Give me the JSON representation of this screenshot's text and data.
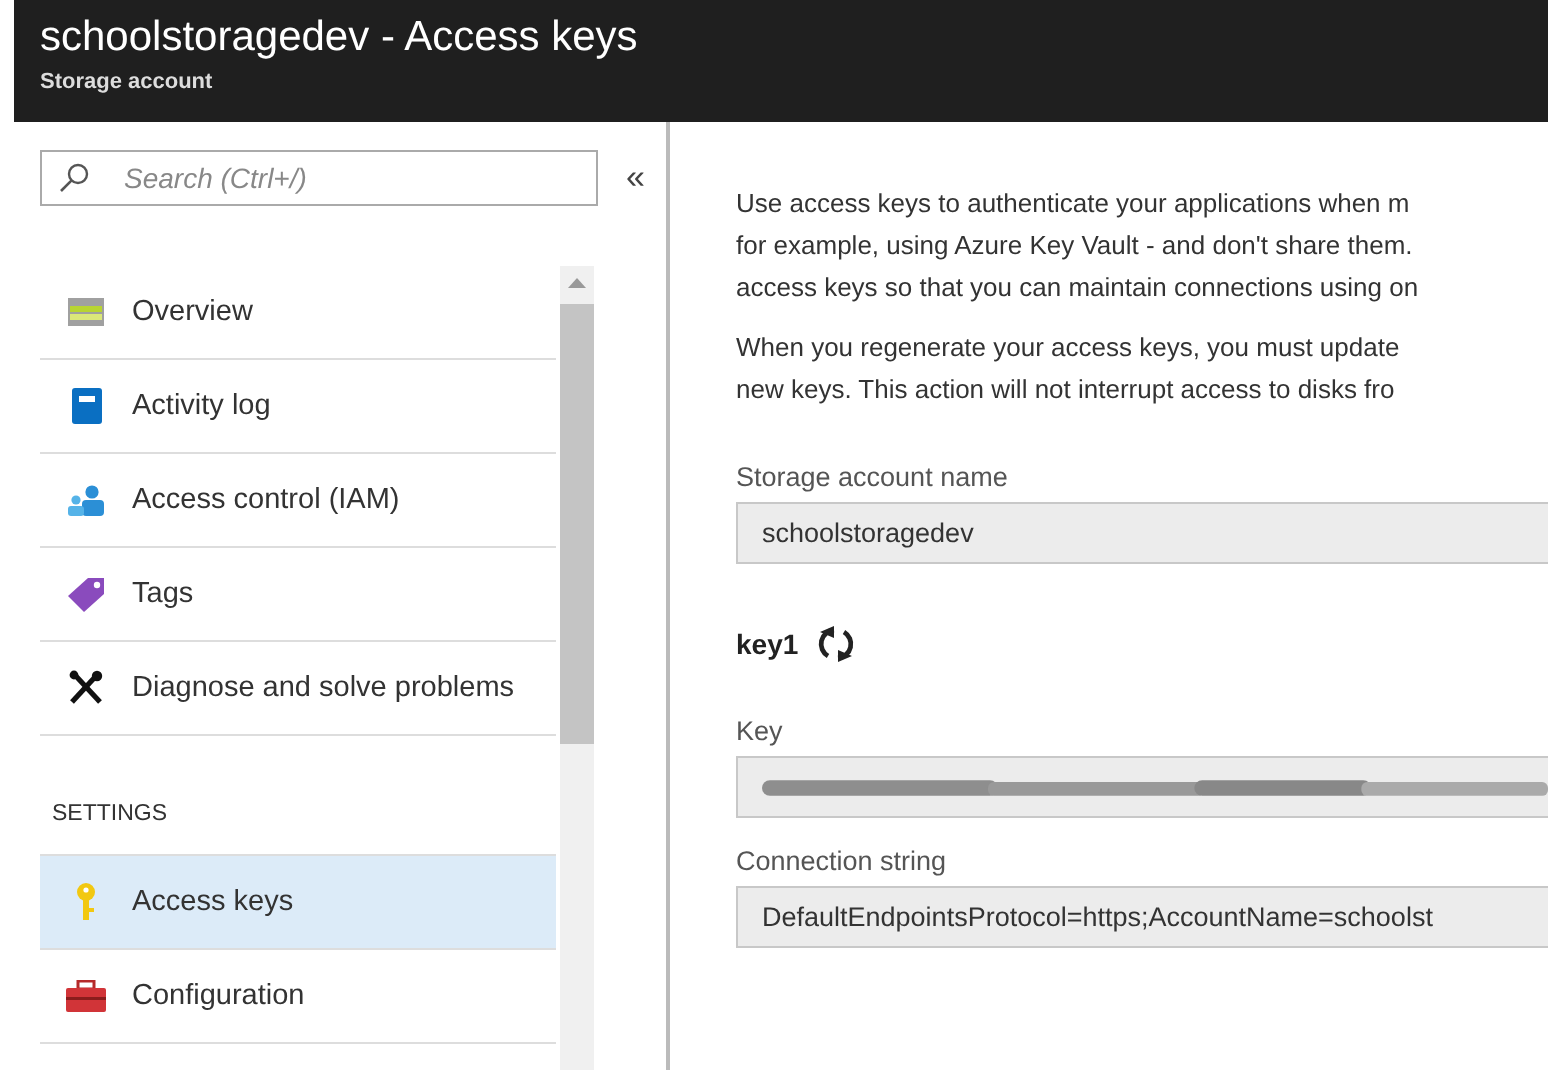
{
  "header": {
    "title": "schoolstoragedev - Access keys",
    "subtitle": "Storage account"
  },
  "sidebar": {
    "search": {
      "placeholder": "Search (Ctrl+/)"
    },
    "collapse": "«",
    "sections": [
      {
        "items": [
          {
            "label": "Overview",
            "kind": "overview",
            "selected": false
          },
          {
            "label": "Activity log",
            "kind": "log",
            "selected": false
          },
          {
            "label": "Access control (IAM)",
            "kind": "iam",
            "selected": false
          },
          {
            "label": "Tags",
            "kind": "tag",
            "selected": false
          },
          {
            "label": "Diagnose and solve problems",
            "kind": "tools",
            "selected": false
          }
        ]
      },
      {
        "heading": "SETTINGS",
        "items": [
          {
            "label": "Access keys",
            "kind": "key",
            "selected": true
          },
          {
            "label": "Configuration",
            "kind": "toolbox",
            "selected": false
          }
        ]
      }
    ]
  },
  "content": {
    "paragraphs": [
      [
        "Use access keys to authenticate your applications when m",
        "for example, using Azure Key Vault - and don't share them.",
        "access keys so that you can maintain connections using on"
      ],
      [
        "When you regenerate your access keys, you must update",
        "new keys. This action will not interrupt access to disks fro"
      ]
    ],
    "account_name": {
      "label": "Storage account name",
      "value": "schoolstoragedev"
    },
    "key1": {
      "title": "key1",
      "fields": [
        {
          "label": "Key",
          "kind": "redacted"
        },
        {
          "label": "Connection string",
          "kind": "text",
          "value": "DefaultEndpointsProtocol=https;AccountName=schoolst"
        }
      ]
    }
  }
}
